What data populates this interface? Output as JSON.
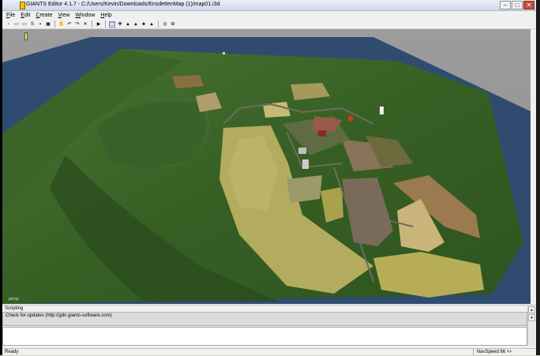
{
  "window": {
    "title": "GIANTS Editor 4.1.7 - C:/Users/Kevin/Downloads/EnsdettenMap (1)/map01.i3d",
    "controls": {
      "minimize": "–",
      "maximize": "□",
      "close": "✕"
    }
  },
  "menu": [
    {
      "label": "File"
    },
    {
      "label": "Edit"
    },
    {
      "label": "Create"
    },
    {
      "label": "View"
    },
    {
      "label": "Window"
    },
    {
      "label": "Help"
    }
  ],
  "toolbar": {
    "buttons": [
      {
        "name": "new-icon",
        "glyph": "▫"
      },
      {
        "name": "open-icon",
        "glyph": "▭"
      },
      {
        "name": "import-icon",
        "glyph": "▭"
      },
      {
        "name": "save-script-icon",
        "glyph": "S"
      },
      {
        "name": "save-icon",
        "glyph": "▪"
      },
      {
        "name": "save-as-icon",
        "glyph": "▣"
      },
      {
        "name": "hand-icon",
        "glyph": "✋"
      },
      {
        "name": "undo-icon",
        "glyph": "↶"
      },
      {
        "name": "redo-icon",
        "glyph": "↷"
      },
      {
        "name": "delete-icon",
        "glyph": "✕"
      },
      {
        "name": "play-icon",
        "glyph": "▶"
      },
      {
        "name": "select-icon",
        "glyph": "⬚"
      },
      {
        "name": "move-icon",
        "glyph": "✥"
      },
      {
        "name": "terrain-sculpt-icon",
        "glyph": "▲"
      },
      {
        "name": "terrain-paint-icon",
        "glyph": "▲"
      },
      {
        "name": "foliage-paint-icon",
        "glyph": "♣"
      },
      {
        "name": "terrain-detail-icon",
        "glyph": "▲"
      },
      {
        "name": "snap-icon",
        "glyph": "◎"
      },
      {
        "name": "settings-icon",
        "glyph": "⚙"
      }
    ]
  },
  "viewport": {
    "camera_label": "persp",
    "colors": {
      "background": "#9a9a9a",
      "water": "#2f4c70",
      "terrain": "#3e6a2a"
    }
  },
  "scripting": {
    "title": "Scripting",
    "log_line": "Check for updates (http://gdn.giants-software.com)"
  },
  "status": {
    "left": "Ready",
    "right": "NavSpeed 86 +/-"
  }
}
